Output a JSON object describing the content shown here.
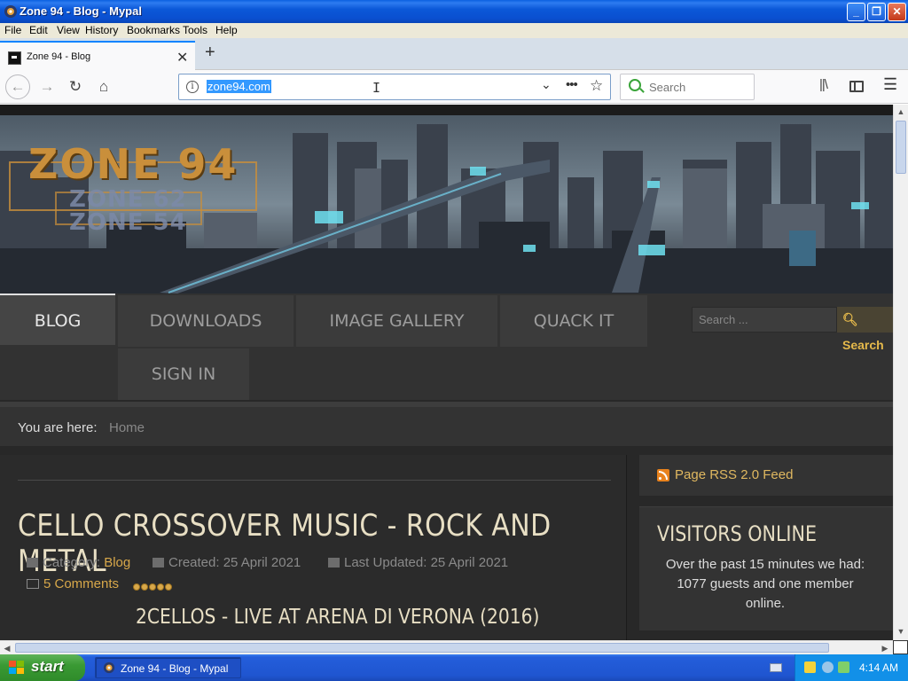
{
  "window": {
    "title": "Zone 94 - Blog - Mypal"
  },
  "menubar": {
    "items": [
      "File",
      "Edit",
      "View",
      "History",
      "Bookmarks",
      "Tools",
      "Help"
    ]
  },
  "tab": {
    "title": "Zone 94 - Blog"
  },
  "toolbar": {
    "url": "zone94.com",
    "search_placeholder": "Search"
  },
  "site": {
    "logo": {
      "main": "ZONE 94",
      "line2": "ZONE 62",
      "line3": "ZONE 54"
    },
    "nav": {
      "blog": "BLOG",
      "downloads": "DOWNLOADS",
      "gallery": "IMAGE GALLERY",
      "quack": "QUACK IT",
      "signin": "SIGN IN"
    },
    "search": {
      "placeholder": "Search ...",
      "button": "Search"
    },
    "breadcrumb": {
      "label": "You are here:",
      "home": "Home"
    },
    "article": {
      "title": "CELLO CROSSOVER MUSIC - ROCK AND METAL",
      "category_label": "Category:",
      "category": "Blog",
      "created": "Created: 25 April 2021",
      "updated": "Last Updated: 25 April 2021",
      "comments": "5 Comments",
      "rating": 5,
      "subheading": "2CELLOS - LIVE AT ARENA DI VERONA (2016)"
    },
    "rss": {
      "label": "Page RSS 2.0 Feed"
    },
    "visitors": {
      "title": "VISITORS ONLINE",
      "body": "Over the past 15 minutes we had: 1077 guests and one member online."
    }
  },
  "taskbar": {
    "start": "start",
    "item": "Zone 94 - Blog - Mypal",
    "clock": "4:14 AM"
  },
  "colors": {
    "accent": "#d8a84a",
    "xp_blue": "#245edb",
    "selection": "#3399ff"
  }
}
